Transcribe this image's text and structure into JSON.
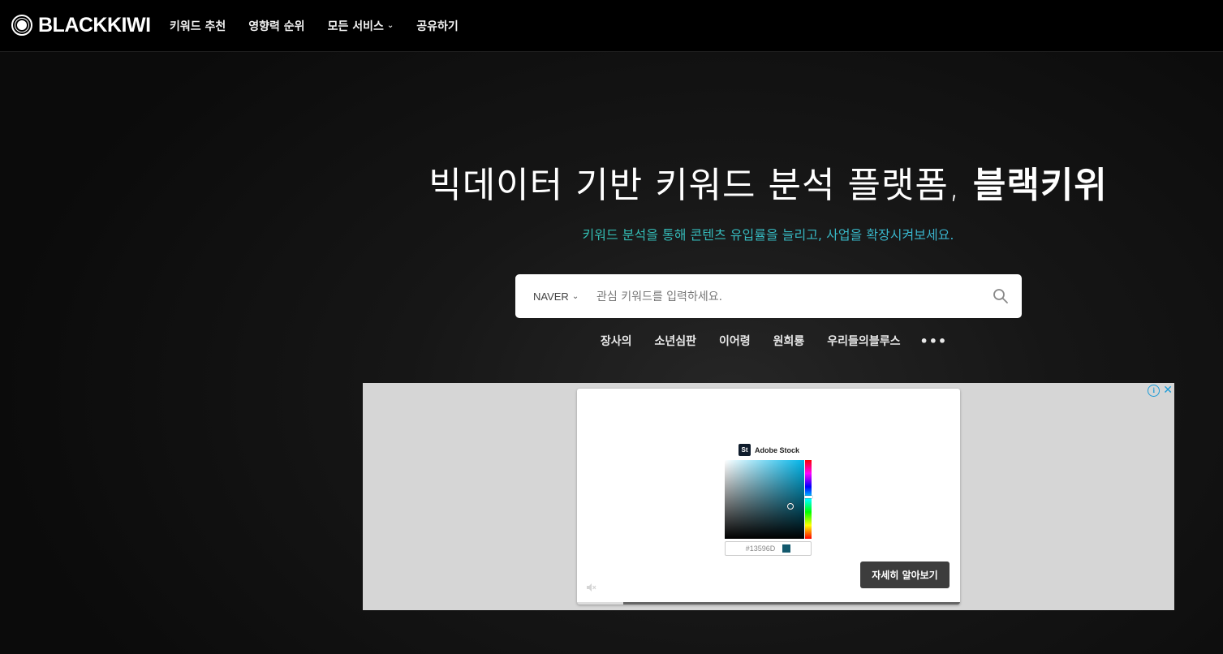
{
  "header": {
    "logo_text": "BLACKKIWI",
    "nav": [
      {
        "label": "키워드 추천"
      },
      {
        "label": "영향력 순위"
      },
      {
        "label": "모든 서비스",
        "has_dropdown": true
      },
      {
        "label": "공유하기"
      }
    ]
  },
  "hero": {
    "title_main": "빅데이터 기반 키워드 분석 플랫폼, ",
    "title_bold": "블랙키위",
    "subtitle": "키워드 분석을 통해 콘텐츠 유입률을 늘리고, 사업을 확장시켜보세요."
  },
  "search": {
    "engine": "NAVER",
    "placeholder": "관심 키워드를 입력하세요.",
    "icon": "search-icon"
  },
  "trending": [
    "장사의",
    "소년심판",
    "이어령",
    "원희룡",
    "우리들의블루스"
  ],
  "ad": {
    "brand_mark": "St",
    "brand_name": "Adobe Stock",
    "hex_value": "#13596D",
    "swatch_color": "#13596D",
    "cta_label": "자세히 알아보기",
    "progress": 0.12
  },
  "colors": {
    "accent_green": "#2ec4a0",
    "accent_blue": "#3fa9e0",
    "ad_info": "#1a9bd7"
  }
}
